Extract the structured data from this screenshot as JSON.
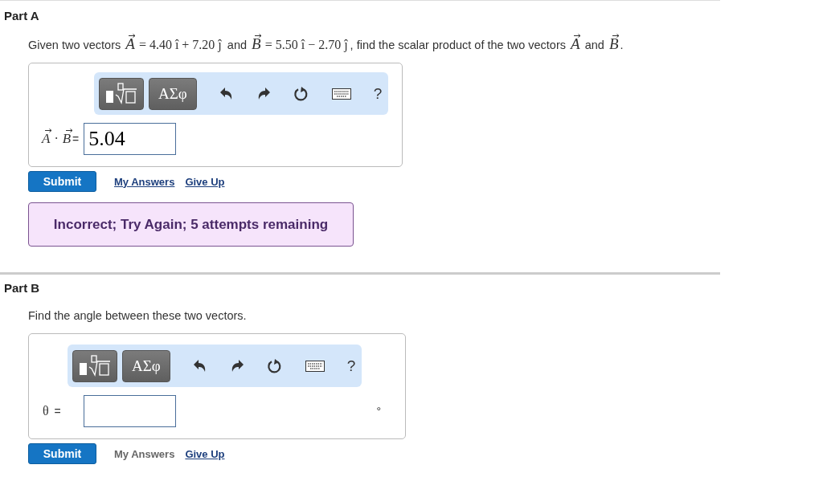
{
  "parts": [
    {
      "title": "Part A",
      "prompt": [
        {
          "kind": "text",
          "text": "Given two vectors "
        },
        {
          "kind": "vector",
          "text": "A"
        },
        {
          "kind": "math",
          "text": "= 4.40 î + 7.20 ĵ"
        },
        {
          "kind": "text",
          "text": " and "
        },
        {
          "kind": "vector",
          "text": "B"
        },
        {
          "kind": "math",
          "text": "= 5.50 î − 2.70 ĵ"
        },
        {
          "kind": "text",
          "text": ", find the scalar product of the two vectors "
        },
        {
          "kind": "vector",
          "text": "A"
        },
        {
          "kind": "text",
          "text": " and "
        },
        {
          "kind": "vector",
          "text": "B"
        },
        {
          "kind": "text",
          "text": "."
        }
      ],
      "toolbar": {
        "greek": "ΑΣφ",
        "help": "?"
      },
      "answer_label": [
        {
          "kind": "vector",
          "text": "A"
        },
        {
          "kind": "math",
          "text": "·"
        },
        {
          "kind": "vector",
          "text": "B"
        },
        {
          "kind": "text",
          "text": "="
        }
      ],
      "answer_value": "5.04",
      "submit": "Submit",
      "links": [
        {
          "label": "My Answers",
          "disabled": false
        },
        {
          "label": "Give Up",
          "disabled": false
        }
      ],
      "feedback": "Incorrect; Try Again; 5 attempts remaining"
    },
    {
      "title": "Part B",
      "prompt": [
        {
          "kind": "text",
          "text": "Find the angle between these two vectors."
        }
      ],
      "toolbar": {
        "greek": "ΑΣφ",
        "help": "?"
      },
      "answer_label": [
        {
          "kind": "math",
          "text": "θ"
        },
        {
          "kind": "text",
          "text": " ="
        }
      ],
      "unit": "°",
      "submit": "Submit",
      "links": [
        {
          "label": "My Answers",
          "disabled": true
        },
        {
          "label": "Give Up",
          "disabled": false
        }
      ]
    }
  ]
}
